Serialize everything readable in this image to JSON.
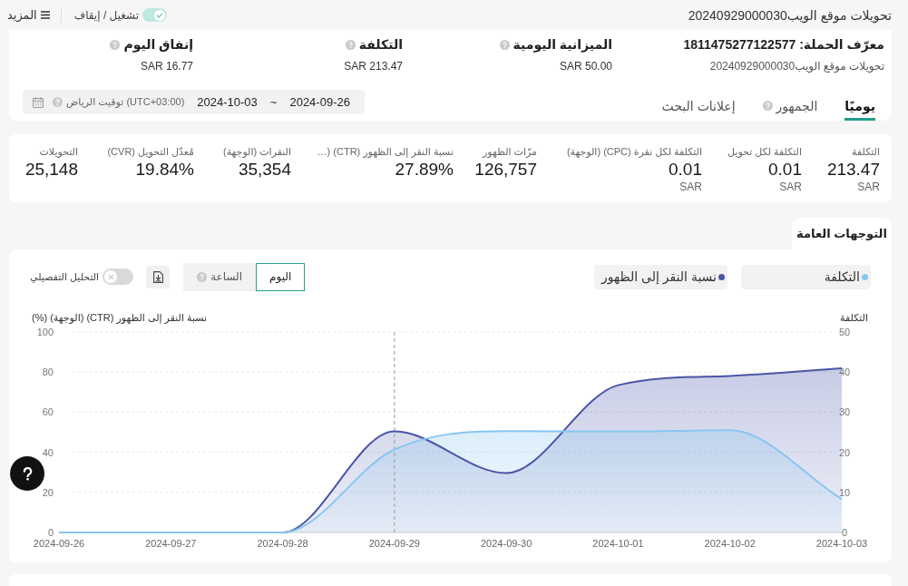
{
  "header": {
    "title": "تحويلات موقع الويب20240929000030",
    "status_toggle": {
      "label": "تشغيل / إيقاف",
      "on": true
    },
    "more_button": "المزيد"
  },
  "campaign": {
    "id_label": "معرّف الحملة: 1811475277122577",
    "name": "تحويلات موقع الويب20240929000030",
    "fields": [
      {
        "label": "الميزانية اليومية",
        "help": true,
        "value": "SAR 50.00"
      },
      {
        "label": "التكلفة",
        "help": true,
        "value": "SAR 213.47"
      },
      {
        "label": "إنفاق اليوم",
        "help": true,
        "value": "SAR 16.77"
      }
    ]
  },
  "tabs": [
    {
      "label": "يوميًا",
      "selected": true,
      "help": false
    },
    {
      "label": "الجمهور",
      "selected": false,
      "help": true
    },
    {
      "label": "إعلانات البحث",
      "selected": false,
      "help": false
    }
  ],
  "date_range": {
    "start": "2024-09-26",
    "separator": "~",
    "end": "2024-10-03",
    "timezone": "(UTC+03:00) توقيت الرياض",
    "help": true
  },
  "metrics": [
    {
      "label": "التكلفة",
      "value": "213.47",
      "unit": "SAR"
    },
    {
      "label": "التكلفة لكل تحويل",
      "value": "0.01",
      "unit": "SAR"
    },
    {
      "label": "التكلفة لكل نقرة (CPC) (الوجهة)",
      "value": "0.01",
      "unit": "SAR"
    },
    {
      "label": "مرّات الظهور",
      "value": "126,757"
    },
    {
      "label": "نسبة النقر إلى الظهور (CTR) (…",
      "value": "27.89%"
    },
    {
      "label": "النقرات (الوجهة)",
      "value": "35,354"
    },
    {
      "label": "مُعدّل التحويل (CVR)",
      "value": "19.84%"
    },
    {
      "label": "التحويلات",
      "value": "25,148"
    }
  ],
  "trends": {
    "tab": "التوجهات العامة",
    "granularity": [
      {
        "label": "اليوم",
        "selected": true,
        "help": false
      },
      {
        "label": "الساعة",
        "selected": false,
        "help": true
      }
    ],
    "detail_toggle": {
      "label": "التحليل التفصيلي",
      "on": false
    },
    "chart_data": {
      "type": "area",
      "categories": [
        "2024-09-26",
        "2024-09-27",
        "2024-09-28",
        "2024-09-29",
        "2024-09-30",
        "2024-10-01",
        "2024-10-02",
        "2024-10-03"
      ],
      "series": [
        {
          "name": "التكلفة",
          "color": "#88c6f0",
          "axis": "y2",
          "values": [
            0,
            0,
            0,
            20.7,
            25.3,
            25.2,
            25.5,
            8.3
          ]
        },
        {
          "name": "نسبة النقر إلى الظهور",
          "color": "#4a55a8",
          "values": [
            0,
            0,
            0,
            50.4,
            29.6,
            73.5,
            78.1,
            81.9
          ]
        }
      ],
      "ylabel": "نسبة النقر إلى الظهور (CTR) (الوجهة) (%)",
      "ylim": [
        0,
        100
      ],
      "yticks": [
        0,
        20,
        40,
        60,
        80,
        100
      ],
      "y2label": "التكلفة",
      "y2lim": [
        0,
        50
      ],
      "y2ticks": [
        0,
        10,
        20,
        30,
        40,
        50
      ],
      "grid": true,
      "ref_lines": [
        {
          "axis": "x",
          "value": "2024-09-29"
        }
      ]
    }
  }
}
